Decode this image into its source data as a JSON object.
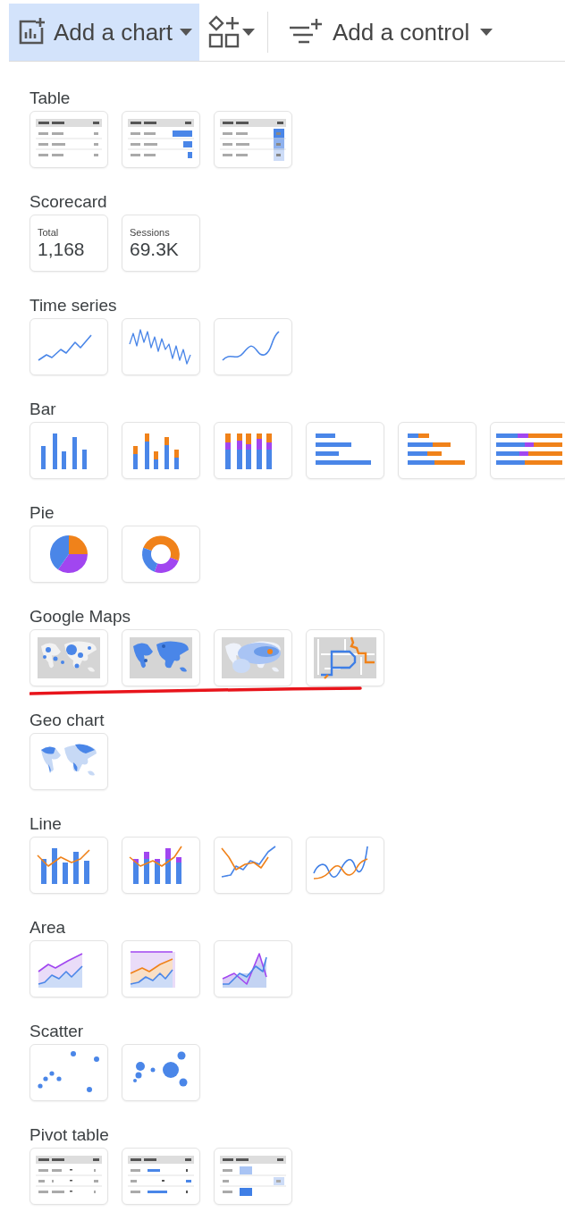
{
  "toolbar": {
    "buttons": [
      {
        "kind": "chart",
        "label": "Add a chart",
        "selected": true
      },
      {
        "kind": "shapes",
        "selected": false
      },
      {
        "kind": "control",
        "label": "Add a control",
        "selected": false
      }
    ]
  },
  "sections": [
    {
      "title": "Table",
      "tiles": [
        {
          "kind": "table"
        },
        {
          "kind": "table-bars"
        },
        {
          "kind": "table-heatmap"
        }
      ]
    },
    {
      "title": "Scorecard",
      "tiles": [
        {
          "kind": "scorecard",
          "label": "Total",
          "value": "1,168"
        },
        {
          "kind": "scorecard",
          "label": "Sessions",
          "value": "69.3K"
        }
      ]
    },
    {
      "title": "Time series",
      "tiles": [
        {
          "kind": "timeseries"
        },
        {
          "kind": "sparkline"
        },
        {
          "kind": "smooth-timeseries"
        }
      ]
    },
    {
      "title": "Bar",
      "tiles": [
        {
          "kind": "column"
        },
        {
          "kind": "stacked-column"
        },
        {
          "kind": "column-100"
        },
        {
          "kind": "bar"
        },
        {
          "kind": "stacked-bar"
        },
        {
          "kind": "bar-100"
        }
      ]
    },
    {
      "title": "Pie",
      "tiles": [
        {
          "kind": "pie"
        },
        {
          "kind": "donut"
        }
      ]
    },
    {
      "title": "Google Maps",
      "underlined": true,
      "tiles": [
        {
          "kind": "bubble-map"
        },
        {
          "kind": "filled-map"
        },
        {
          "kind": "heatmap-map"
        },
        {
          "kind": "line-map"
        }
      ]
    },
    {
      "title": "Geo chart",
      "tiles": [
        {
          "kind": "geo"
        }
      ]
    },
    {
      "title": "Line",
      "tiles": [
        {
          "kind": "combo"
        },
        {
          "kind": "stacked-combo"
        },
        {
          "kind": "line"
        },
        {
          "kind": "smooth-line"
        }
      ]
    },
    {
      "title": "Area",
      "tiles": [
        {
          "kind": "area"
        },
        {
          "kind": "area-100"
        },
        {
          "kind": "area-overlap"
        }
      ]
    },
    {
      "title": "Scatter",
      "tiles": [
        {
          "kind": "scatter"
        },
        {
          "kind": "bubble"
        }
      ]
    },
    {
      "title": "Pivot table",
      "tiles": [
        {
          "kind": "pivot"
        },
        {
          "kind": "pivot-bars"
        },
        {
          "kind": "pivot-heatmap"
        }
      ]
    }
  ]
}
